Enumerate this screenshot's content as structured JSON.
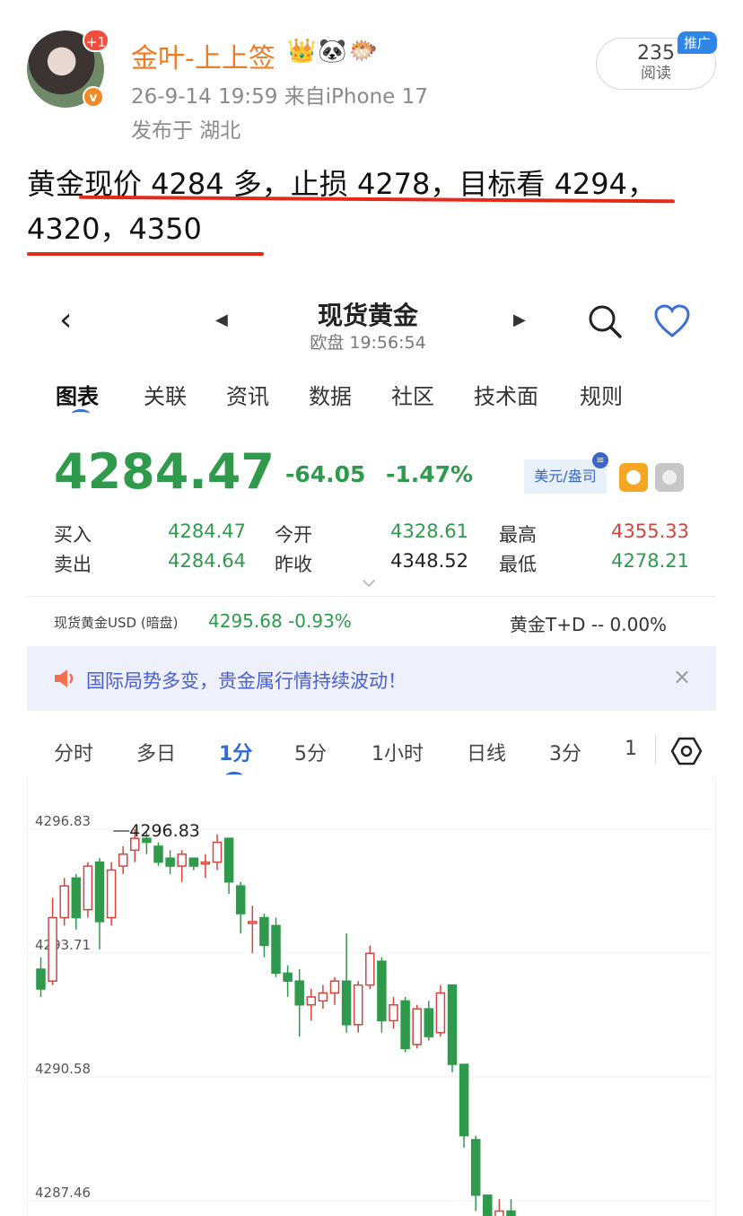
{
  "post": {
    "avatar_badge": "+1",
    "verified_badge": "v",
    "username": "金叶-上上签",
    "emojis": "👑🐼🐡",
    "meta": "26-9-14 19:59  来自iPhone 17",
    "location": "发布于 湖北",
    "read_count": "235",
    "read_label": "阅读",
    "promo_label": "推广",
    "text_line1": "黄金现价 4284 多，止损 4278，目标看 4294，",
    "text_line2": "4320，4350"
  },
  "app": {
    "title": "现货黄金",
    "subtitle": "欧盘 19:56:54",
    "tabs": [
      "图表",
      "关联",
      "资讯",
      "数据",
      "社区",
      "技术面",
      "规则"
    ],
    "price": "4284.47",
    "change": "-64.05",
    "change_pct": "-1.47%",
    "currency": "美元/盎司",
    "currency_badge": "≡",
    "quotes": {
      "buy_label": "买入",
      "buy": "4284.47",
      "sell_label": "卖出",
      "sell": "4284.64",
      "open_label": "今开",
      "open": "4328.61",
      "prev_close_label": "昨收",
      "prev_close": "4348.52",
      "high_label": "最高",
      "high": "4355.33",
      "low_label": "最低",
      "low": "4278.21"
    },
    "sub_left_label": "现货黄金USD (暗盘)",
    "sub_left_value": "4295.68  -0.93%",
    "sub_right": "黄金T+D  --  0.00%",
    "banner_text": "国际局势多变，贵金属行情持续波动！",
    "banner_close": "×",
    "period_tabs": [
      "分时",
      "多日",
      "1分",
      "5分",
      "1小时",
      "日线",
      "3分",
      "1"
    ],
    "colors": {
      "up": "#d3443c",
      "down": "#2f9a4c",
      "accent": "#2e6ad8"
    }
  },
  "chart_data": {
    "type": "candlestick",
    "y_ticks": [
      "4296.83",
      "4293.71",
      "4290.58",
      "4287.46"
    ],
    "max_label": "4296.83",
    "candles": [
      {
        "o": 4293.3,
        "c": 4292.8,
        "h": 4293.6,
        "l": 4292.6
      },
      {
        "o": 4293.0,
        "c": 4294.6,
        "h": 4295.1,
        "l": 4292.9
      },
      {
        "o": 4294.6,
        "c": 4295.4,
        "h": 4295.6,
        "l": 4294.4
      },
      {
        "o": 4295.6,
        "c": 4294.6,
        "h": 4295.7,
        "l": 4294.3
      },
      {
        "o": 4294.8,
        "c": 4295.9,
        "h": 4296.0,
        "l": 4294.6
      },
      {
        "o": 4296.0,
        "c": 4294.5,
        "h": 4296.1,
        "l": 4293.8
      },
      {
        "o": 4294.6,
        "c": 4295.8,
        "h": 4296.0,
        "l": 4294.4
      },
      {
        "o": 4295.9,
        "c": 4296.2,
        "h": 4296.4,
        "l": 4295.7
      },
      {
        "o": 4296.3,
        "c": 4296.6,
        "h": 4296.83,
        "l": 4296.0
      },
      {
        "o": 4296.6,
        "c": 4296.5,
        "h": 4296.8,
        "l": 4296.2
      },
      {
        "o": 4296.4,
        "c": 4296.0,
        "h": 4296.5,
        "l": 4295.9
      },
      {
        "o": 4296.1,
        "c": 4295.9,
        "h": 4296.3,
        "l": 4295.7
      },
      {
        "o": 4295.9,
        "c": 4296.2,
        "h": 4296.3,
        "l": 4295.5
      },
      {
        "o": 4296.1,
        "c": 4295.9,
        "h": 4296.1,
        "l": 4295.8
      },
      {
        "o": 4296.0,
        "c": 4296.0,
        "h": 4296.2,
        "l": 4295.6
      },
      {
        "o": 4296.0,
        "c": 4296.5,
        "h": 4296.7,
        "l": 4295.8
      },
      {
        "o": 4296.6,
        "c": 4295.5,
        "h": 4296.6,
        "l": 4295.2
      },
      {
        "o": 4295.4,
        "c": 4294.7,
        "h": 4295.5,
        "l": 4294.2
      },
      {
        "o": 4294.5,
        "c": 4294.5,
        "h": 4294.9,
        "l": 4293.7
      },
      {
        "o": 4294.6,
        "c": 4293.9,
        "h": 4294.7,
        "l": 4293.6
      },
      {
        "o": 4294.4,
        "c": 4293.2,
        "h": 4294.6,
        "l": 4293.1
      },
      {
        "o": 4293.2,
        "c": 4293.0,
        "h": 4293.4,
        "l": 4292.6
      },
      {
        "o": 4293.0,
        "c": 4292.4,
        "h": 4293.3,
        "l": 4291.6
      },
      {
        "o": 4292.4,
        "c": 4292.6,
        "h": 4292.8,
        "l": 4292.0
      },
      {
        "o": 4292.5,
        "c": 4292.7,
        "h": 4292.9,
        "l": 4292.3
      },
      {
        "o": 4292.7,
        "c": 4293.0,
        "h": 4293.1,
        "l": 4292.4
      },
      {
        "o": 4293.0,
        "c": 4291.9,
        "h": 4294.2,
        "l": 4291.7
      },
      {
        "o": 4291.9,
        "c": 4292.9,
        "h": 4293.0,
        "l": 4291.7
      },
      {
        "o": 4292.9,
        "c": 4293.7,
        "h": 4293.9,
        "l": 4292.8
      },
      {
        "o": 4293.5,
        "c": 4292.0,
        "h": 4293.6,
        "l": 4291.7
      },
      {
        "o": 4292.0,
        "c": 4292.4,
        "h": 4292.6,
        "l": 4291.8
      },
      {
        "o": 4292.5,
        "c": 4291.3,
        "h": 4292.6,
        "l": 4291.2
      },
      {
        "o": 4291.4,
        "c": 4292.3,
        "h": 4292.4,
        "l": 4291.3
      },
      {
        "o": 4292.3,
        "c": 4291.6,
        "h": 4292.5,
        "l": 4291.5
      },
      {
        "o": 4291.7,
        "c": 4292.7,
        "h": 4292.9,
        "l": 4291.6
      },
      {
        "o": 4292.9,
        "c": 4290.9,
        "h": 4292.9,
        "l": 4290.7
      },
      {
        "o": 4290.9,
        "c": 4289.1,
        "h": 4290.9,
        "l": 4288.8
      },
      {
        "o": 4289.0,
        "c": 4287.6,
        "h": 4289.1,
        "l": 4287.2
      },
      {
        "o": 4287.6,
        "c": 4286.8,
        "h": 4287.6,
        "l": 4286.5
      },
      {
        "o": 4286.8,
        "c": 4287.2,
        "h": 4287.5,
        "l": 4286.6
      },
      {
        "o": 4287.2,
        "c": 4286.4,
        "h": 4287.5,
        "l": 4286.3
      }
    ]
  }
}
